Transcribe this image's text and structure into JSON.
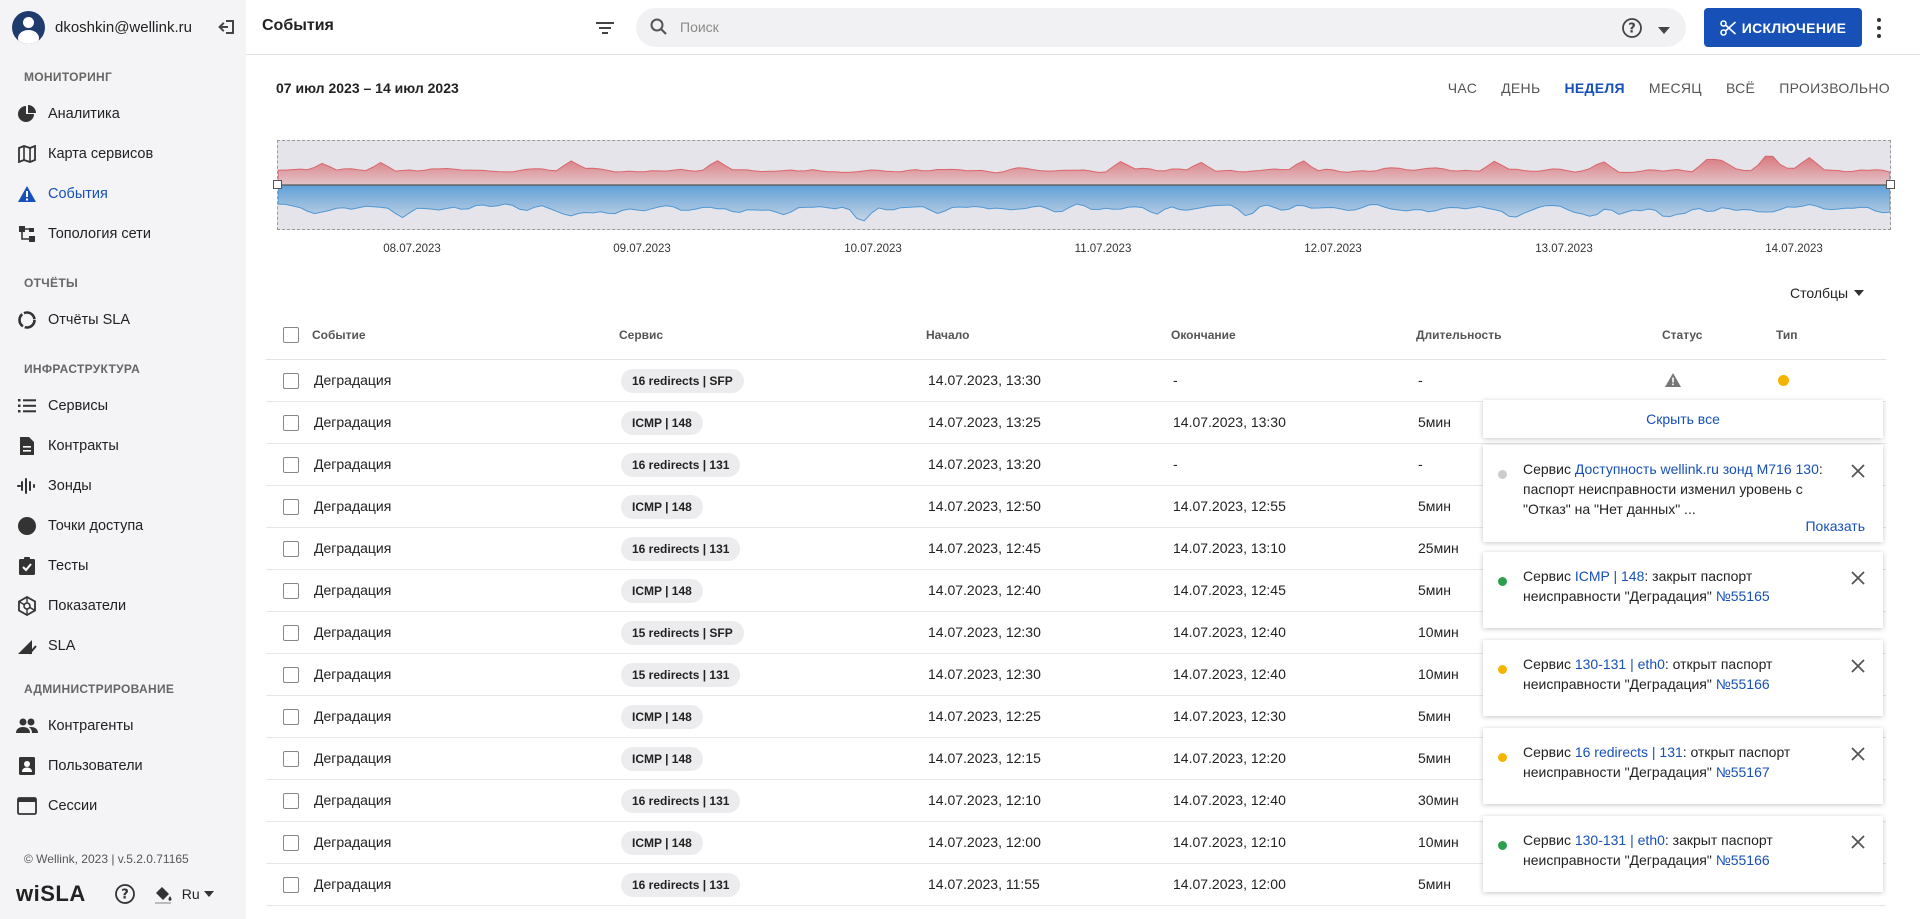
{
  "user": {
    "email": "dkoshkin@wellink.ru"
  },
  "sidebar": {
    "sections": [
      {
        "title": "МОНИТОРИНГ"
      },
      {
        "title": "ОТЧЁТЫ"
      },
      {
        "title": "ИНФРАСТРУКТУРА"
      },
      {
        "title": "АДМИНИСТРИРОВАНИЕ"
      }
    ],
    "items": [
      {
        "label": "Аналитика",
        "icon": "pie-chart-icon"
      },
      {
        "label": "Карта сервисов",
        "icon": "map-icon"
      },
      {
        "label": "События",
        "icon": "warning-icon",
        "active": true
      },
      {
        "label": "Топология сети",
        "icon": "topology-icon"
      },
      {
        "label": "Отчёты SLA",
        "icon": "donut-icon"
      },
      {
        "label": "Сервисы",
        "icon": "list-icon"
      },
      {
        "label": "Контракты",
        "icon": "document-icon"
      },
      {
        "label": "Зонды",
        "icon": "signal-icon"
      },
      {
        "label": "Точки доступа",
        "icon": "circle-icon"
      },
      {
        "label": "Тесты",
        "icon": "clipboard-check-icon"
      },
      {
        "label": "Показатели",
        "icon": "hexagon-icon"
      },
      {
        "label": "SLA",
        "icon": "sla-icon"
      },
      {
        "label": "Контрагенты",
        "icon": "people-icon"
      },
      {
        "label": "Пользователи",
        "icon": "user-card-icon"
      },
      {
        "label": "Сессии",
        "icon": "window-icon"
      }
    ],
    "footer_version": "© Wellink, 2023 | v.5.2.0.71165",
    "logo_main": "wiSLA",
    "lang": "Ru"
  },
  "header": {
    "title": "События",
    "search_placeholder": "Поиск",
    "exclusion_label": "ИСКЛЮЧЕНИЕ"
  },
  "period": {
    "range": "07 июл 2023 – 14 июл 2023",
    "options": [
      {
        "label": "ЧАС"
      },
      {
        "label": "ДЕНЬ"
      },
      {
        "label": "НЕДЕЛЯ",
        "active": true
      },
      {
        "label": "МЕСЯЦ"
      },
      {
        "label": "ВСЁ"
      },
      {
        "label": "ПРОИЗВОЛЬНО"
      }
    ]
  },
  "timeline": {
    "dates": [
      "08.07.2023",
      "09.07.2023",
      "10.07.2023",
      "11.07.2023",
      "12.07.2023",
      "13.07.2023",
      "14.07.2023"
    ],
    "colors": {
      "top": "#d9666b",
      "bottom": "#4f97d4"
    }
  },
  "table": {
    "columns_button": "Столбцы",
    "headers": {
      "event": "Событие",
      "service": "Сервис",
      "start": "Начало",
      "end": "Окончание",
      "duration": "Длительность",
      "status": "Статус",
      "type": "Тип"
    },
    "rows": [
      {
        "event": "Деградация",
        "service": "16 redirects | SFP",
        "start": "14.07.2023, 13:30",
        "end": "-",
        "duration": "-",
        "status": "warning-icon",
        "type_color": "#f4b400"
      },
      {
        "event": "Деградация",
        "service": "ICMP | 148",
        "start": "14.07.2023, 13:25",
        "end": "14.07.2023, 13:30",
        "duration": "5мин"
      },
      {
        "event": "Деградация",
        "service": "16 redirects | 131",
        "start": "14.07.2023, 13:20",
        "end": "-",
        "duration": "-"
      },
      {
        "event": "Деградация",
        "service": "ICMP | 148",
        "start": "14.07.2023, 12:50",
        "end": "14.07.2023, 12:55",
        "duration": "5мин"
      },
      {
        "event": "Деградация",
        "service": "16 redirects | 131",
        "start": "14.07.2023, 12:45",
        "end": "14.07.2023, 13:10",
        "duration": "25мин"
      },
      {
        "event": "Деградация",
        "service": "ICMP | 148",
        "start": "14.07.2023, 12:40",
        "end": "14.07.2023, 12:45",
        "duration": "5мин"
      },
      {
        "event": "Деградация",
        "service": "15 redirects | SFP",
        "start": "14.07.2023, 12:30",
        "end": "14.07.2023, 12:40",
        "duration": "10мин"
      },
      {
        "event": "Деградация",
        "service": "15 redirects | 131",
        "start": "14.07.2023, 12:30",
        "end": "14.07.2023, 12:40",
        "duration": "10мин"
      },
      {
        "event": "Деградация",
        "service": "ICMP | 148",
        "start": "14.07.2023, 12:25",
        "end": "14.07.2023, 12:30",
        "duration": "5мин"
      },
      {
        "event": "Деградация",
        "service": "ICMP | 148",
        "start": "14.07.2023, 12:15",
        "end": "14.07.2023, 12:20",
        "duration": "5мин"
      },
      {
        "event": "Деградация",
        "service": "16 redirects | 131",
        "start": "14.07.2023, 12:10",
        "end": "14.07.2023, 12:40",
        "duration": "30мин"
      },
      {
        "event": "Деградация",
        "service": "ICMP | 148",
        "start": "14.07.2023, 12:00",
        "end": "14.07.2023, 12:10",
        "duration": "10мин"
      },
      {
        "event": "Деградация",
        "service": "16 redirects | 131",
        "start": "14.07.2023, 11:55",
        "end": "14.07.2023, 12:00",
        "duration": "5мин"
      }
    ]
  },
  "notifications": {
    "hide_all": "Скрыть все",
    "show_label": "Показать",
    "items": [
      {
        "dot_color": "#cccccc",
        "prefix": "Сервис ",
        "link": "Доступность wellink.ru зонд M716 130",
        "suffix": ": паспорт неисправности изменил уровень с \"Отказ\" на \"Нет данных\" ...",
        "num": ""
      },
      {
        "dot_color": "#2e9e4f",
        "prefix": "Сервис ",
        "link": "ICMP | 148",
        "suffix": ": закрыт паспорт неисправности \"Деградация\" ",
        "num": "№55165"
      },
      {
        "dot_color": "#f4b400",
        "prefix": "Сервис ",
        "link": "130-131 | eth0",
        "suffix": ": открыт паспорт неисправности \"Деградация\" ",
        "num": "№55166"
      },
      {
        "dot_color": "#f4b400",
        "prefix": "Сервис ",
        "link": "16 redirects | 131",
        "suffix": ": открыт паспорт неисправности \"Деградация\" ",
        "num": "№55167"
      },
      {
        "dot_color": "#2e9e4f",
        "prefix": "Сервис ",
        "link": "130-131 | eth0",
        "suffix": ": закрыт паспорт неисправности \"Деградация\" ",
        "num": "№55166"
      }
    ]
  }
}
